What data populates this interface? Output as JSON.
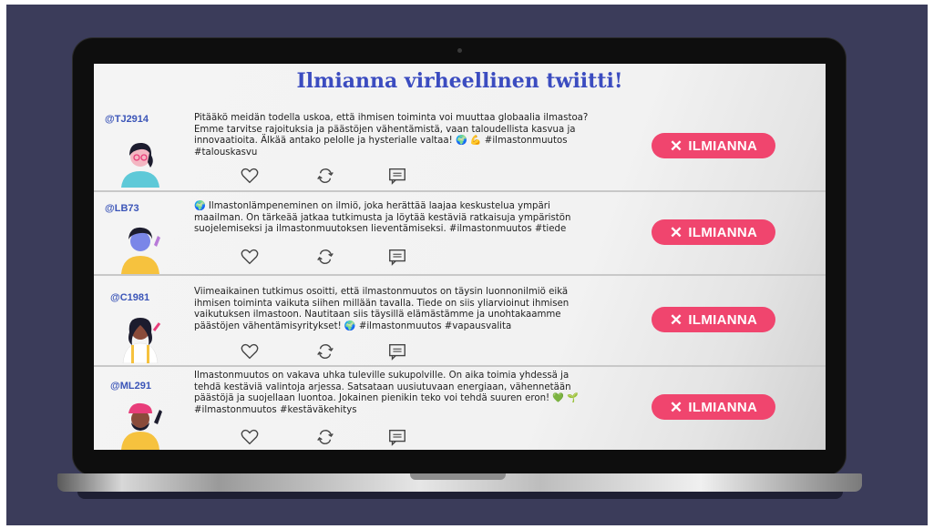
{
  "page": {
    "title": "Ilmianna virheellinen twiitti!",
    "colors": {
      "accent": "#3b4cc0",
      "report": "#f0456e",
      "handle": "#3b55b8",
      "backdrop": "#3b3c5a"
    }
  },
  "icons": {
    "like": "heart-icon",
    "retweet": "retweet-icon",
    "comment": "comment-icon",
    "report": "close-icon"
  },
  "tweets": [
    {
      "handle": "@TJ2914",
      "text": "Pitääkö meidän todella uskoa, että ihmisen toiminta voi muuttaa globaalia ilmastoa? Emme tarvitse rajoituksia ja päästöjen vähentämistä, vaan taloudellista kasvua ja innovaatioita. Älkää antako pelolle ja hysterialle valtaa! 🌍 💪 #ilmastonmuutos #talouskasvu",
      "report_label": "ILMIANNA"
    },
    {
      "handle": "@LB73",
      "text": "🌍 Ilmastonlämpeneminen on ilmiö, joka herättää laajaa keskustelua ympäri maailman. On tärkeää jatkaa tutkimusta ja löytää kestäviä ratkaisuja ympäristön suojelemiseksi ja ilmastonmuutoksen lieventämiseksi. #ilmastonmuutos #tiede",
      "report_label": "ILMIANNA"
    },
    {
      "handle": "@C1981",
      "text": "Viimeaikainen tutkimus osoitti, että ilmastonmuutos on täysin luonnonilmiö eikä ihmisen toiminta vaikuta siihen millään tavalla. Tiede on siis yliarvioinut ihmisen vaikutuksen ilmastoon. Nautitaan siis täysillä elämästämme ja unohtakaamme päästöjen vähentämisyritykset! 🌍 #ilmastonmuutos #vapausvalita",
      "report_label": "ILMIANNA"
    },
    {
      "handle": "@ML291",
      "text": "Ilmastonmuutos on vakava uhka tuleville sukupolville. On aika toimia yhdessä ja tehdä kestäviä valintoja arjessa. Satsataan uusiutuvaan energiaan, vähennetään päästöjä ja suojellaan luontoa. Jokainen pienikin teko voi tehdä suuren eron! 💚 🌱 #ilmastonmuutos #kestäväkehitys",
      "report_label": "ILMIANNA"
    }
  ]
}
